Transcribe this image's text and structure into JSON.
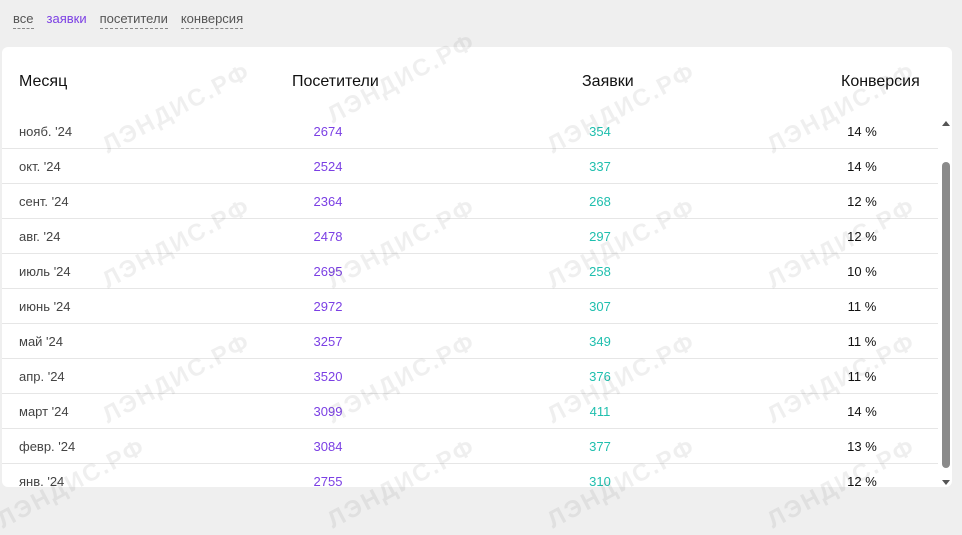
{
  "filters": [
    "все",
    "заявки",
    "посетители",
    "конверсия"
  ],
  "table": {
    "headers": {
      "month": "Месяц",
      "visitors": "Посетители",
      "leads": "Заявки",
      "conversion": "Конверсия"
    },
    "rows": [
      {
        "month": "нояб. '24",
        "visitors": "2674",
        "leads": "354",
        "conversion": "14 %"
      },
      {
        "month": "окт. '24",
        "visitors": "2524",
        "leads": "337",
        "conversion": "14 %"
      },
      {
        "month": "сент. '24",
        "visitors": "2364",
        "leads": "268",
        "conversion": "12 %"
      },
      {
        "month": "авг. '24",
        "visitors": "2478",
        "leads": "297",
        "conversion": "12 %"
      },
      {
        "month": "июль '24",
        "visitors": "2695",
        "leads": "258",
        "conversion": "10 %"
      },
      {
        "month": "июнь '24",
        "visitors": "2972",
        "leads": "307",
        "conversion": "11 %"
      },
      {
        "month": "май '24",
        "visitors": "3257",
        "leads": "349",
        "conversion": "11 %"
      },
      {
        "month": "апр. '24",
        "visitors": "3520",
        "leads": "376",
        "conversion": "11 %"
      },
      {
        "month": "март '24",
        "visitors": "3099",
        "leads": "411",
        "conversion": "14 %"
      },
      {
        "month": "февр. '24",
        "visitors": "3084",
        "leads": "377",
        "conversion": "13 %"
      },
      {
        "month": "янв. '24",
        "visitors": "2755",
        "leads": "310",
        "conversion": "12 %"
      }
    ]
  },
  "watermark": "ЛЭНДИС.РФ",
  "colors": {
    "accent": "#7b3fe4",
    "leads": "#1fbfae",
    "background": "#efefef"
  }
}
